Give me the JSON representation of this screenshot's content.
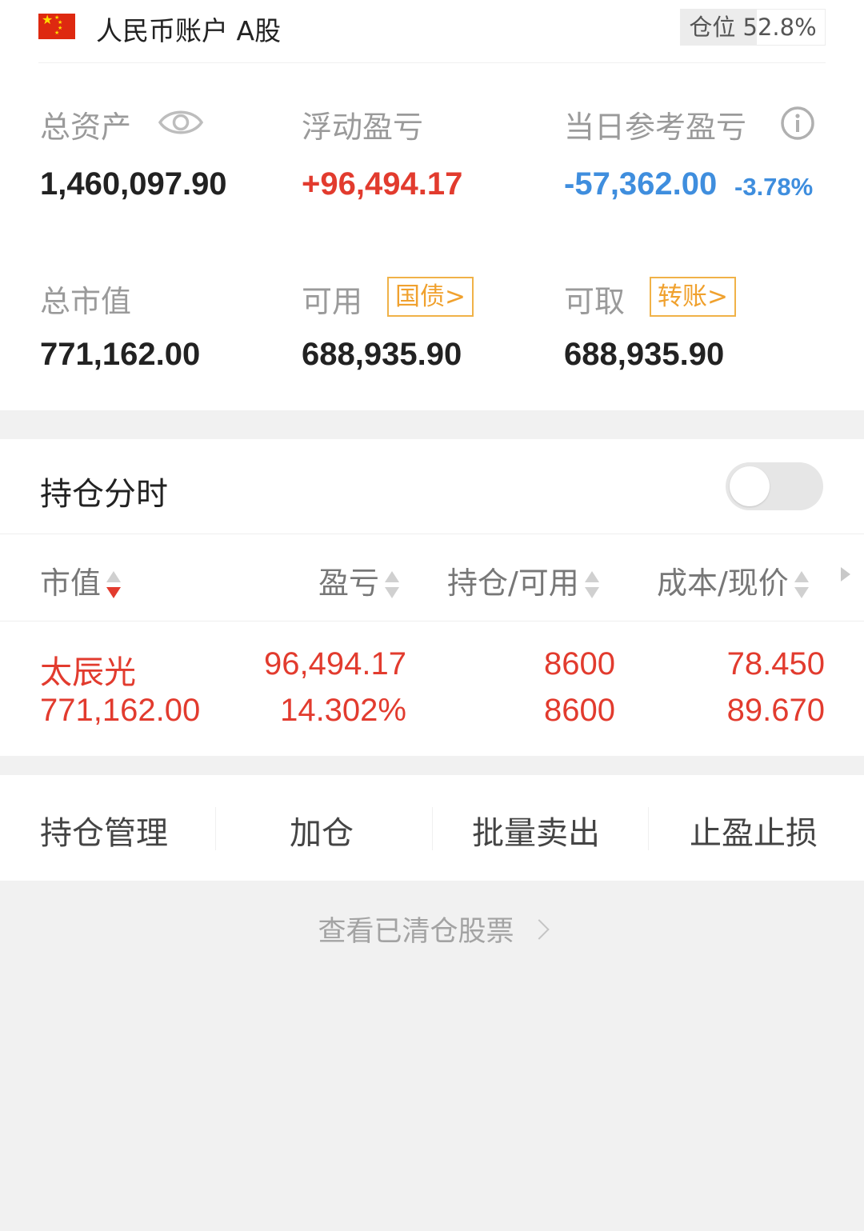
{
  "account": {
    "title": "人民币账户 A股",
    "position_label": "仓位 52.8%",
    "position_ratio": 0.528,
    "flag_colors": {
      "red": "#de2910",
      "star": "#ffde00"
    }
  },
  "metrics": {
    "total_assets": {
      "label": "总资产",
      "value": "1,460,097.90",
      "icon": "eye-icon"
    },
    "floating_pl": {
      "label": "浮动盈亏",
      "value": "+96,494.17",
      "color": "#e23b2e"
    },
    "daily_pl": {
      "label": "当日参考盈亏",
      "value": "-57,362.00",
      "pct": "-3.78%",
      "icon": "info-icon",
      "color": "#3f8ede"
    },
    "market_value": {
      "label": "总市值",
      "value": "771,162.00"
    },
    "available": {
      "label": "可用",
      "value": "688,935.90",
      "tag": "国债>"
    },
    "withdrawable": {
      "label": "可取",
      "value": "688,935.90",
      "tag": "转账>"
    }
  },
  "timeshare": {
    "label": "持仓分时",
    "toggle_on": false
  },
  "table": {
    "headers": [
      "市值",
      "盈亏",
      "持仓/可用",
      "成本/现价"
    ],
    "rows": [
      {
        "name": "太辰光",
        "market_value": "771,162.00",
        "pl": "96,494.17",
        "pl_pct": "14.302%",
        "position": "8600",
        "available": "8600",
        "cost": "78.450",
        "price": "89.670"
      }
    ]
  },
  "actions": [
    "持仓管理",
    "加仓",
    "批量卖出",
    "止盈止损"
  ],
  "cleared_link": "查看已清仓股票"
}
